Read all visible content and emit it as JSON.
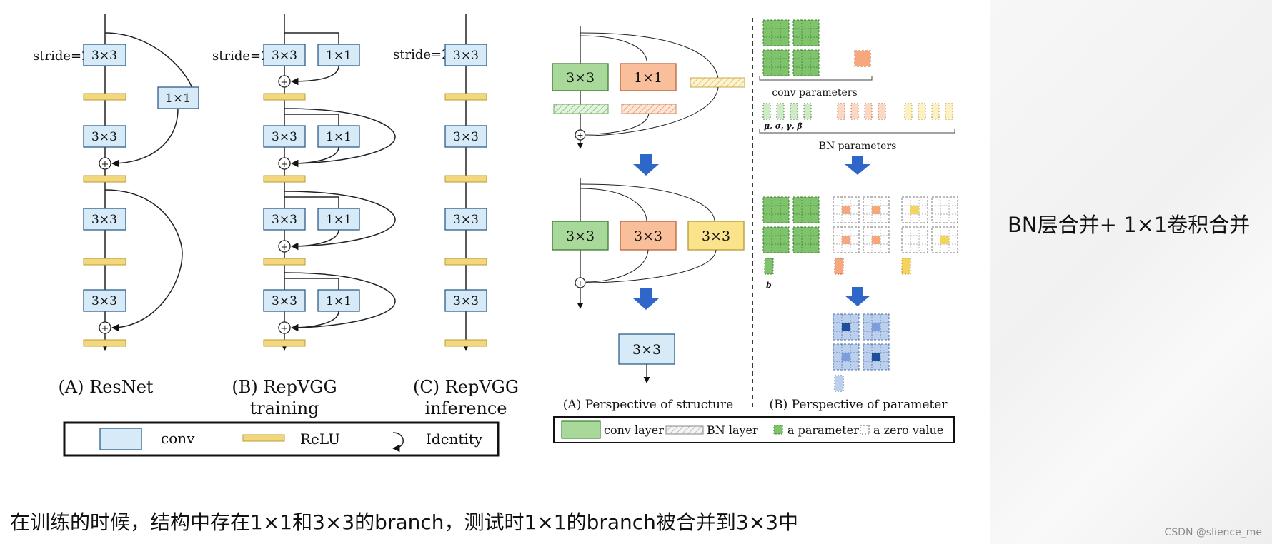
{
  "diagram_left": {
    "stride_label": "stride=2",
    "k3": "3×3",
    "k1": "1×1",
    "plus": "+",
    "captions": {
      "resnet": "(A) ResNet",
      "repvgg_train_1": "(B) RepVGG",
      "repvgg_train_2": "training",
      "repvgg_inf_1": "(C) RepVGG",
      "repvgg_inf_2": "inference"
    },
    "legend": {
      "conv": "conv",
      "relu": "ReLU",
      "identity": "Identity"
    }
  },
  "diagram_right": {
    "conv_parameters": "conv parameters",
    "bn_parameters": "BN parameters",
    "bn_symbols": "μ, σ, γ, β",
    "bias_symbol": "b",
    "caption_structure": "(A) Perspective of structure",
    "caption_parameter": "(B) Perspective of parameter",
    "legend": {
      "conv_layer": "conv layer",
      "bn_layer": "BN layer",
      "a_parameter": "a parameter",
      "a_zero_value": "a zero value"
    }
  },
  "side_title": "BN层合并+ 1×1卷积合并",
  "bottom_caption": "在训练的时候，结构中存在1×1和3×3的branch，测试时1×1的branch被合并到3×3中",
  "watermark": "CSDN @slience_me",
  "colors": {
    "conv_blue": "#d6eaf8",
    "relu_yellow": "#f3d77d",
    "green": "#a8d99a",
    "orange": "#f9bf9b",
    "yellow": "#fbe38b",
    "merged_blue": "#bcd0ee",
    "arrow_blue": "#2f66c9"
  }
}
